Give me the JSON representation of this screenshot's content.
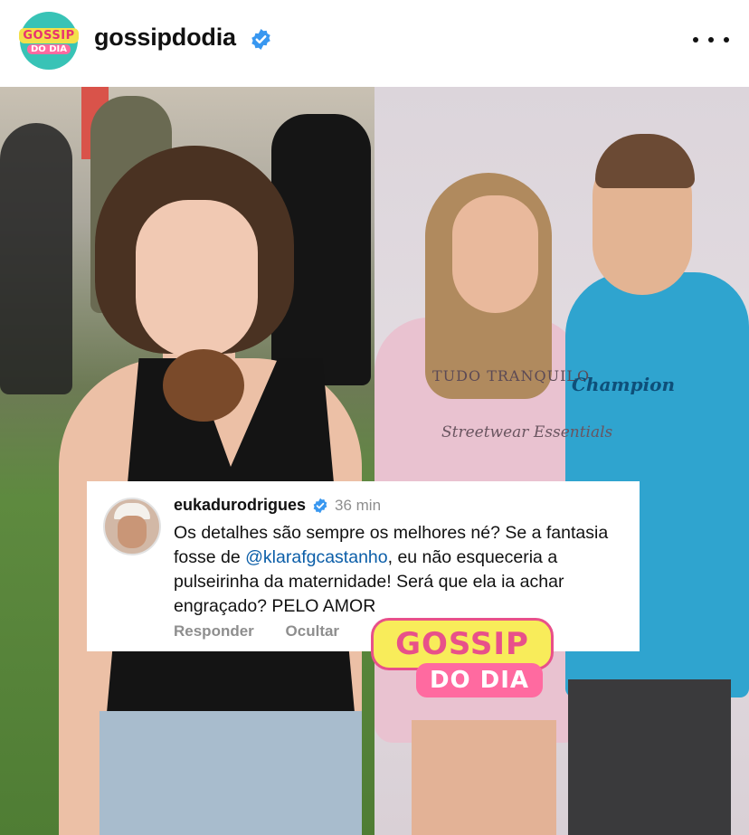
{
  "post": {
    "account": {
      "username": "gossipdodia",
      "avatar_line1": "GOSSIP",
      "avatar_line2": "DO DIA",
      "verified": true
    },
    "more_icon": "more-horizontal-icon",
    "image": {
      "shirt_line1": "TUDO TRANQUILO",
      "shirt_line2": "Streetwear Essentials",
      "hoodie_brand": "Champion",
      "watermark_line1": "GOSSIP",
      "watermark_line2": "DO DIA"
    },
    "comment": {
      "username": "eukadurodrigues",
      "verified": true,
      "time": "36 min",
      "text_before": "Os detalhes são sempre os melhores né? Se a fantasia fosse de ",
      "mention": "@klarafgcastanho",
      "text_after": ", eu não esqueceria a pulseirinha da maternidade!  Será que ela ia achar engraçado? PELO AMOR",
      "action_reply": "Responder",
      "action_hide": "Ocultar"
    },
    "colors": {
      "verified_blue": "#3897f0",
      "mention_blue": "#0b5ea8",
      "brand_teal": "#38c3b6",
      "brand_pink": "#e8508a",
      "brand_yellow": "#f8ec5a"
    }
  }
}
